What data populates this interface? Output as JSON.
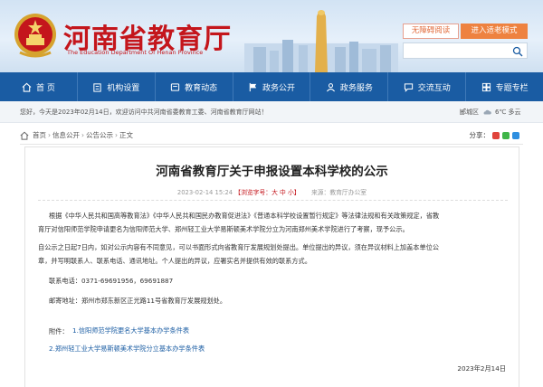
{
  "header": {
    "title": "河南省教育厅",
    "subtitle": "The Education Department Of Henan Province",
    "a11y_button": "无障碍阅读",
    "elder_button": "进入适老模式"
  },
  "nav": {
    "items": [
      {
        "label": "首 页",
        "icon": "home-icon"
      },
      {
        "label": "机构设置",
        "icon": "building-icon"
      },
      {
        "label": "教育动态",
        "icon": "news-icon"
      },
      {
        "label": "政务公开",
        "icon": "flag-icon"
      },
      {
        "label": "政务服务",
        "icon": "service-icon"
      },
      {
        "label": "交流互动",
        "icon": "chat-icon"
      },
      {
        "label": "专题专栏",
        "icon": "topic-icon"
      }
    ]
  },
  "info": {
    "greeting": "您好，今天是2023年02月14日，欢迎访问中共河南省委教育工委、河南省教育厅网站！",
    "city": "郾城区",
    "weather": "6℃ 多云"
  },
  "breadcrumb": [
    "首页",
    "信息公开",
    "公告公示",
    "正文"
  ],
  "share_label": "分享：",
  "colors": {
    "brand_red": "#c4161c",
    "nav_blue": "#1a5ca3",
    "accent_orange": "#ee8240"
  },
  "article": {
    "title": "河南省教育厅关于申报设置本科学校的公示",
    "date": "2023-02-14 15:24",
    "views_label": "【浏览字号：大 中 小】",
    "source": "来源：教育厅办公室",
    "paragraphs": [
      "根据《中华人民共和国高等教育法》《中华人民共和国民办教育促进法》《普通本科学校设置暂行规定》等法律法规和有关政策规定，省教",
      "育厅对信阳师范学院申请更名为信阳师范大学、郑州轻工业大学易斯顿美术学院分立为河南郑州美术学院进行了考察，现予公示。",
      "自公示之日起7日内，如对公示内容有不同意见，可以书面形式向省教育厅发展规划处提出。单位提出的异议，须在异议材料上加盖本单位公",
      "章，并写明联系人、联系电话、通讯地址。个人提出的异议，应署实名并提供有效的联系方式。",
      "联系电话：0371-69691956，69691887",
      "邮寄地址：郑州市郑东新区正光路11号省教育厅发展规划处。"
    ],
    "attachment_intro": "附件：",
    "attachments": [
      "1.信阳师范学院更名大学基本办学条件表",
      "2.郑州轻工业大学易斯顿美术学院分立基本办学条件表"
    ],
    "sign_date": "2023年2月14日"
  }
}
